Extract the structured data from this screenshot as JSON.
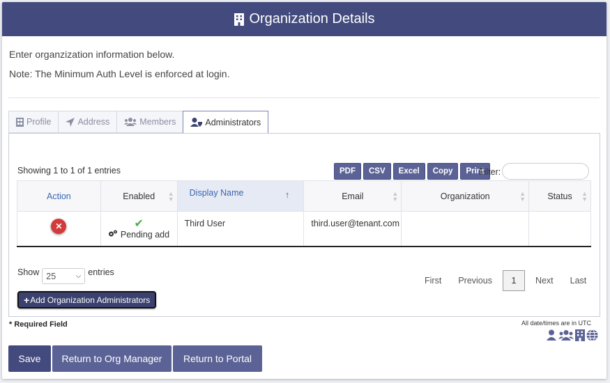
{
  "header": {
    "title": "Organization Details",
    "icon": "building-icon"
  },
  "intro": {
    "line1": "Enter organzization information below.",
    "line2": "Note: The Minimum Auth Level is enforced at login."
  },
  "tabs": [
    {
      "label": "Profile",
      "icon": "id-card-icon"
    },
    {
      "label": "Address",
      "icon": "location-arrow-icon"
    },
    {
      "label": "Members",
      "icon": "users-icon"
    },
    {
      "label": "Administrators",
      "icon": "user-shield-icon",
      "active": true
    }
  ],
  "table_info": {
    "showing": "Showing 1 to 1 of 1 entries",
    "export_buttons": [
      "PDF",
      "CSV",
      "Excel",
      "Copy",
      "Print"
    ],
    "filter_label": "Filter:",
    "filter_value": ""
  },
  "table": {
    "columns": [
      "Action",
      "Enabled",
      "Display Name",
      "Email",
      "Organization",
      "Status"
    ],
    "rows": [
      {
        "enabled_status": "Pending add",
        "display_name": "Third User",
        "email": "third.user@tenant.com",
        "organization": "",
        "status": ""
      }
    ]
  },
  "length_menu": {
    "prefix": "Show",
    "selected": "25",
    "suffix": "entries"
  },
  "pagination": {
    "first": "First",
    "previous": "Previous",
    "current": "1",
    "next": "Next",
    "last": "Last"
  },
  "add_button": "Add Organization Administrators",
  "footer": {
    "required": "* Required Field",
    "utc_note": "All date/times are in UTC",
    "icons": [
      "user-icon",
      "users-icon",
      "building-icon",
      "globe-icon"
    ]
  },
  "buttons": {
    "save": "Save",
    "return_org": "Return to Org Manager",
    "return_portal": "Return to Portal"
  },
  "colors": {
    "header_bg": "#434a7e",
    "button_bg": "#5b6396",
    "delete_red": "#d33a3a",
    "check_green": "#4caa4c",
    "link_blue": "#3a66b0"
  }
}
